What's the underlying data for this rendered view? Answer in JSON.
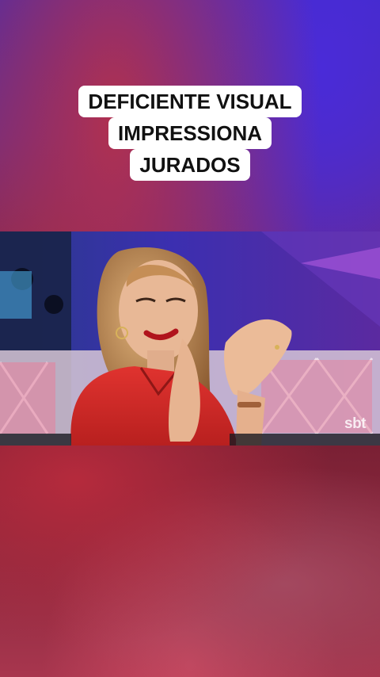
{
  "caption": {
    "lines": [
      "DEFICIENTE VISUAL",
      "IMPRESSIONA",
      "JURADOS"
    ]
  },
  "video": {
    "watermark": "sbt"
  },
  "colors": {
    "caption_bg": "#ffffff",
    "caption_text": "#111111",
    "shirt": "#d42a2e",
    "stage_purple": "#5b2ea6"
  }
}
